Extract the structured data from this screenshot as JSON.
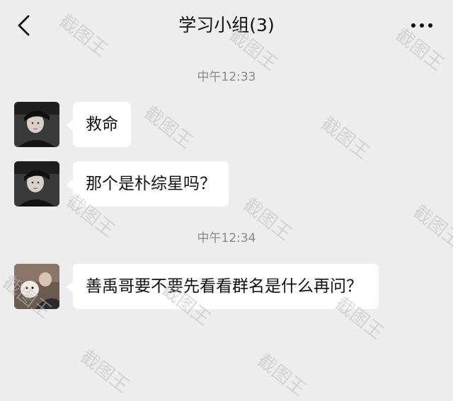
{
  "header": {
    "title": "学习小组(3)"
  },
  "messages": [
    {
      "time": "中午12:33"
    },
    {
      "sender": "member",
      "text": "救命"
    },
    {
      "sender": "member",
      "text": "那个是朴综星吗？"
    },
    {
      "time": "中午12:34"
    },
    {
      "sender": "member",
      "text": "善禹哥要不要先看看群名是什么再问？"
    }
  ],
  "watermark": {
    "text": "截图王"
  },
  "colors": {
    "background": "#ededed",
    "bubble": "#ffffff",
    "time": "#8a8a8a"
  }
}
